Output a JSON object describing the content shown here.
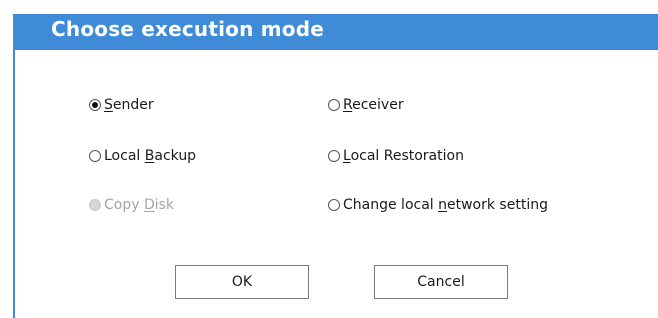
{
  "dialog": {
    "title": "Choose execution mode"
  },
  "options": [
    {
      "id": "sender",
      "pre": "",
      "mnemonic": "S",
      "post": "ender",
      "checked": true,
      "enabled": true
    },
    {
      "id": "receiver",
      "pre": "",
      "mnemonic": "R",
      "post": "eceiver",
      "checked": false,
      "enabled": true
    },
    {
      "id": "local-backup",
      "pre": "Local ",
      "mnemonic": "B",
      "post": "ackup",
      "checked": false,
      "enabled": true
    },
    {
      "id": "local-restoration",
      "pre": "",
      "mnemonic": "L",
      "post": "ocal Restoration",
      "checked": false,
      "enabled": true
    },
    {
      "id": "copy-disk",
      "pre": "Copy ",
      "mnemonic": "D",
      "post": "isk",
      "checked": false,
      "enabled": false
    },
    {
      "id": "change-network",
      "pre": "Change local ",
      "mnemonic": "n",
      "post": "etwork setting",
      "checked": false,
      "enabled": true
    }
  ],
  "buttons": {
    "ok_label": "OK",
    "cancel_label": "Cancel"
  },
  "colors": {
    "titlebar": "#3f8bd8",
    "disabled_text": "#a5a5a5"
  }
}
